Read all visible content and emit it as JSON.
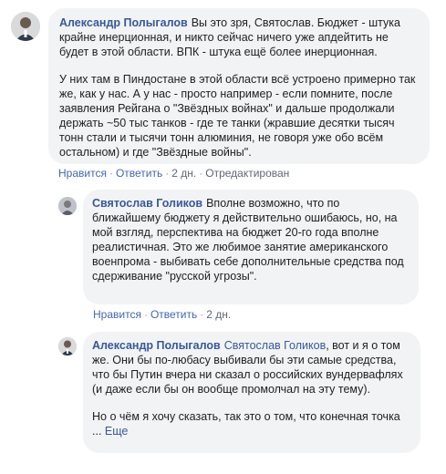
{
  "comments": [
    {
      "author": "Александр Полыгалов",
      "mention": "",
      "paragraphs": [
        "Вы это зря, Святослав. Бюджет - штука крайне инерционная, и никто сейчас ничего уже апдейтить не будет в этой области. ВПК - штука ещё более инерционная.",
        "У них там в Пиндостане в этой области всё устроено примерно так же, как у нас. А у нас - просто например - если помните, после заявления Рейгана о \"Звёздных войнах\" и дальше продолжали держать ~50 тыс танков - где те танки (жравшие десятки тысяч тонн стали и тысячи тонн алюминия, не говоря уже обо всём остальном) и где \"Звёздные войны\"."
      ],
      "like_label": "Нравится",
      "reply_label": "Ответить",
      "time": "2 дн.",
      "edited": "Отредактирован"
    },
    {
      "author": "Святослав Голиков",
      "mention": "",
      "paragraphs": [
        "Вполне возможно, что по ближайшему бюджету я действительно ошибаюсь, но, на мой взгляд, перспектива на бюджет 20-го года вполне реалистичная. Это же любимое занятие американского военпрома - выбивать себе дополнительные средства под сдерживание \"русской угрозы\"."
      ],
      "like_label": "Нравится",
      "reply_label": "Ответить",
      "time": "2 дн.",
      "edited": ""
    },
    {
      "author": "Александр Полыгалов",
      "mention": "Святослав Голиков",
      "paragraphs": [
        ", вот и я о том же. Они бы по-любасу выбивали бы эти самые средства, что бы Путин вчера ни сказал о российских вундервафлях (и даже если бы он вообще промолчал на эту тему).",
        "Но о чём я хочу сказать, так это о том, что конечная точка ..."
      ],
      "more_label": "Еще"
    }
  ],
  "colors": {
    "link": "#385898",
    "action_link": "#4267b2",
    "meta": "#606770",
    "bubble": "#f2f3f5"
  }
}
